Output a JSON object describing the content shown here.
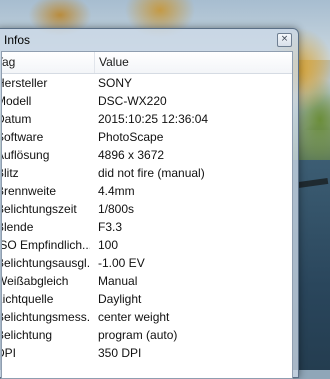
{
  "window": {
    "title": "Infos",
    "close_label": "×"
  },
  "table": {
    "columns": {
      "tag": "Tag",
      "value": "Value"
    },
    "rows": [
      {
        "tag": "Hersteller",
        "value": "SONY"
      },
      {
        "tag": "Modell",
        "value": "DSC-WX220"
      },
      {
        "tag": "Datum",
        "value": "2015:10:25 12:36:04"
      },
      {
        "tag": "Software",
        "value": "PhotoScape"
      },
      {
        "tag": "Auflösung",
        "value": "4896 x 3672"
      },
      {
        "tag": "Blitz",
        "value": "did not fire (manual)"
      },
      {
        "tag": "Brennweite",
        "value": "4.4mm"
      },
      {
        "tag": "Belichtungszeit",
        "value": "1/800s"
      },
      {
        "tag": "Blende",
        "value": "F3.3"
      },
      {
        "tag": "ISO Empfindlich...",
        "value": "100"
      },
      {
        "tag": "Belichtungsausgl...",
        "value": "-1.00 EV"
      },
      {
        "tag": "Weißabgleich",
        "value": "Manual"
      },
      {
        "tag": "Lichtquelle",
        "value": "Daylight"
      },
      {
        "tag": "Belichtungsmess...",
        "value": "center weight"
      },
      {
        "tag": "Belichtung",
        "value": "program (auto)"
      },
      {
        "tag": "DPI",
        "value": "350 DPI"
      }
    ]
  }
}
